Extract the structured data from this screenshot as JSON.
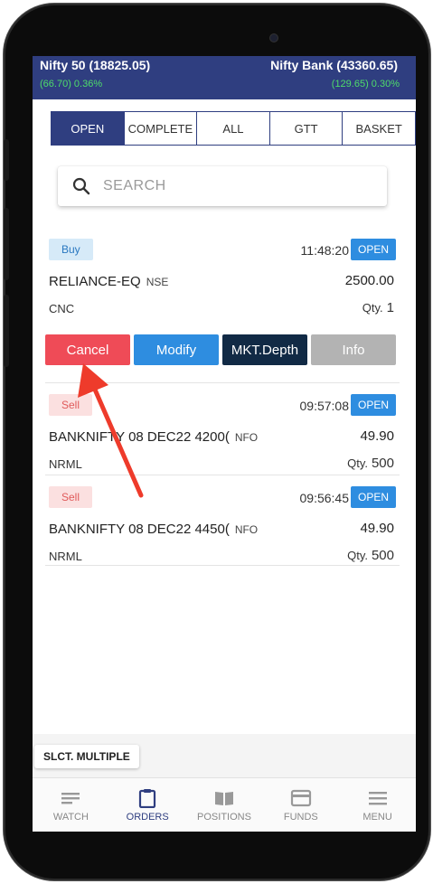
{
  "ticker": {
    "left_name": "Nifty 50 (18825.05)",
    "left_change": "(66.70) 0.36%",
    "right_name": "Nifty Bank (43360.65)",
    "right_change": "(129.65) 0.30%"
  },
  "tabs": [
    {
      "label": "OPEN",
      "active": true
    },
    {
      "label": "COMPLETE",
      "active": false
    },
    {
      "label": "ALL",
      "active": false
    },
    {
      "label": "GTT",
      "active": false
    },
    {
      "label": "BASKET",
      "active": false
    }
  ],
  "search": {
    "placeholder": "SEARCH"
  },
  "orders": [
    {
      "side": "Buy",
      "time": "11:48:20",
      "status": "OPEN",
      "symbol": "RELIANCE-EQ",
      "exchange": "NSE",
      "price": "2500.00",
      "product": "CNC",
      "qty_label": "Qty.",
      "qty": "1"
    },
    {
      "side": "Sell",
      "time": "09:57:08",
      "status": "OPEN",
      "symbol": "BANKNIFTY 08 DEC22 4200(",
      "exchange": "NFO",
      "price": "49.90",
      "product": "NRML",
      "qty_label": "Qty.",
      "qty": "500"
    },
    {
      "side": "Sell",
      "time": "09:56:45",
      "status": "OPEN",
      "symbol": "BANKNIFTY 08 DEC22 4450(",
      "exchange": "NFO",
      "price": "49.90",
      "product": "NRML",
      "qty_label": "Qty.",
      "qty": "500"
    }
  ],
  "actions": {
    "cancel": "Cancel",
    "modify": "Modify",
    "depth": "MKT.Depth",
    "info": "Info"
  },
  "select_multiple": "SLCT. MULTIPLE",
  "nav": [
    {
      "label": "WATCH",
      "icon": "list-icon",
      "active": false
    },
    {
      "label": "ORDERS",
      "icon": "clipboard-icon",
      "active": true
    },
    {
      "label": "POSITIONS",
      "icon": "book-icon",
      "active": false
    },
    {
      "label": "FUNDS",
      "icon": "card-icon",
      "active": false
    },
    {
      "label": "MENU",
      "icon": "menu-icon",
      "active": false
    }
  ],
  "colors": {
    "brand": "#2f3e80",
    "open_badge": "#2e8de0",
    "cancel": "#ef4b57",
    "depth": "#112a45",
    "arrow": "#ee3b2b"
  }
}
